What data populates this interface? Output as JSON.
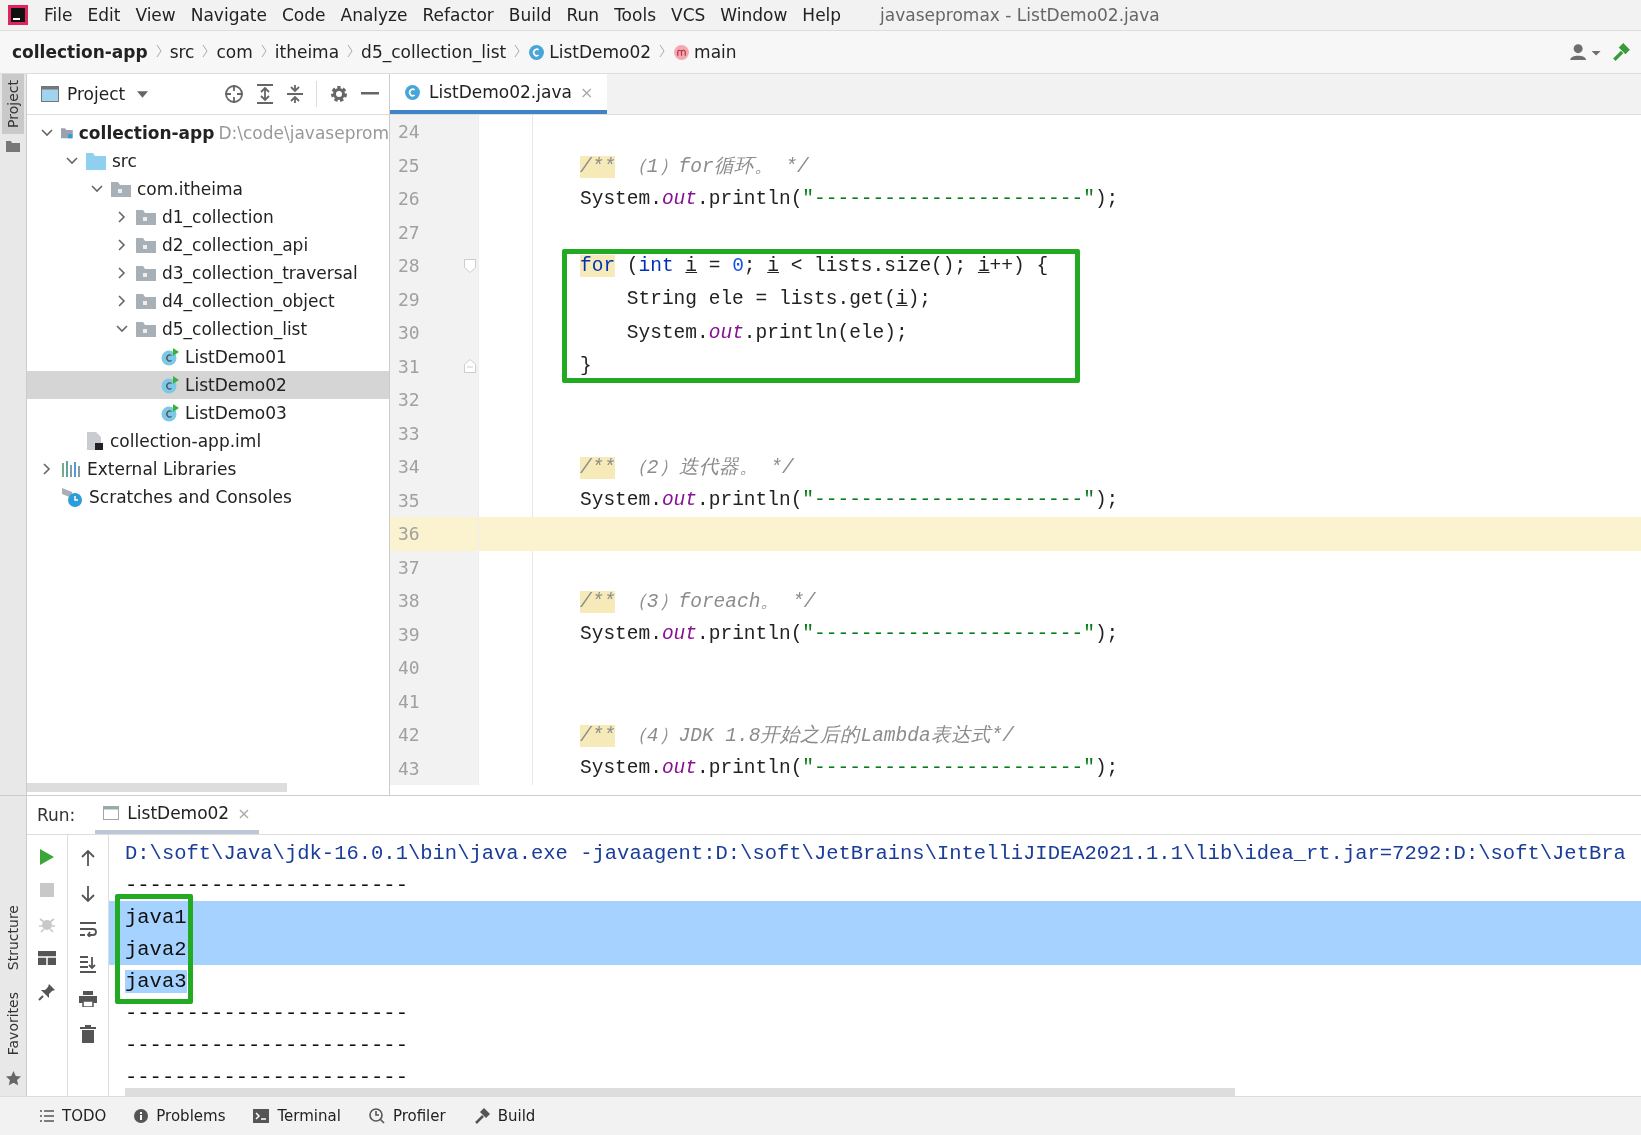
{
  "menu_bar": {
    "items": [
      "File",
      "Edit",
      "View",
      "Navigate",
      "Code",
      "Analyze",
      "Refactor",
      "Build",
      "Run",
      "Tools",
      "VCS",
      "Window",
      "Help"
    ],
    "title": "javasepromax - ListDemo02.java"
  },
  "breadcrumb": [
    {
      "label": "collection-app",
      "kind": "module"
    },
    {
      "label": "src",
      "kind": "folder"
    },
    {
      "label": "com",
      "kind": "folder"
    },
    {
      "label": "itheima",
      "kind": "folder"
    },
    {
      "label": "d5_collection_list",
      "kind": "folder"
    },
    {
      "label": "ListDemo02",
      "kind": "class"
    },
    {
      "label": "main",
      "kind": "method"
    }
  ],
  "left_strip": [
    "Project",
    "Structure",
    "Favorites"
  ],
  "project_panel": {
    "title": "Project",
    "items": [
      {
        "label": "collection-app",
        "note": "D:\\code\\javaseprom",
        "kind": "module",
        "expanded": true,
        "selected": false,
        "children": [
          {
            "label": "src",
            "kind": "source",
            "expanded": true,
            "selected": false,
            "children": [
              {
                "label": "com.itheima",
                "kind": "package",
                "expanded": true,
                "selected": false,
                "children": [
                  {
                    "label": "d1_collection",
                    "kind": "package",
                    "expanded": false,
                    "selected": false
                  },
                  {
                    "label": "d2_collection_api",
                    "kind": "package",
                    "expanded": false,
                    "selected": false
                  },
                  {
                    "label": "d3_collection_traversal",
                    "kind": "package",
                    "expanded": false,
                    "selected": false
                  },
                  {
                    "label": "d4_collection_object",
                    "kind": "package",
                    "expanded": false,
                    "selected": false
                  },
                  {
                    "label": "d5_collection_list",
                    "kind": "package",
                    "expanded": true,
                    "selected": false,
                    "children": [
                      {
                        "label": "ListDemo01",
                        "kind": "class",
                        "selected": false
                      },
                      {
                        "label": "ListDemo02",
                        "kind": "class",
                        "selected": true
                      },
                      {
                        "label": "ListDemo03",
                        "kind": "class",
                        "selected": false
                      }
                    ]
                  }
                ]
              }
            ]
          },
          {
            "label": "collection-app.iml",
            "kind": "file",
            "selected": false
          }
        ]
      },
      {
        "label": "External Libraries",
        "kind": "library",
        "expanded": false,
        "selected": false
      },
      {
        "label": "Scratches and Consoles",
        "kind": "scratch",
        "selected": false
      }
    ]
  },
  "editor": {
    "tab": {
      "label": "ListDemo02.java",
      "close": "×",
      "selected": true
    },
    "lines": [
      {
        "number": "24",
        "kind": "code",
        "current": false,
        "boxed": false
      },
      {
        "number": "25",
        "kind": "code",
        "current": false,
        "boxed": false,
        "segments": [
          {
            "kind": "marker",
            "text": "/**"
          },
          {
            "kind": "comment",
            "text": " （1）for循环。 */"
          }
        ]
      },
      {
        "number": "26",
        "kind": "code",
        "current": false,
        "boxed": false,
        "segments": [
          {
            "kind": "plain",
            "text": "System."
          },
          {
            "kind": "field",
            "text": "out"
          },
          {
            "kind": "plain",
            "text": ".println("
          },
          {
            "kind": "string",
            "text": "\"-----------------------\""
          },
          {
            "kind": "plain",
            "text": ");"
          }
        ]
      },
      {
        "number": "27",
        "kind": "code",
        "current": false,
        "boxed": false
      },
      {
        "number": "28",
        "kind": "fold-start",
        "current": false,
        "boxed": true,
        "segments": [
          {
            "kind": "keyword-match",
            "text": "for"
          },
          {
            "kind": "plain",
            "text": " ("
          },
          {
            "kind": "keyword",
            "text": "int "
          },
          {
            "kind": "var",
            "text": "i"
          },
          {
            "kind": "plain",
            "text": " = "
          },
          {
            "kind": "number",
            "text": "0"
          },
          {
            "kind": "plain",
            "text": "; "
          },
          {
            "kind": "var",
            "text": "i"
          },
          {
            "kind": "plain",
            "text": " < lists.size(); "
          },
          {
            "kind": "var",
            "text": "i"
          },
          {
            "kind": "plain",
            "text": "++) {"
          }
        ]
      },
      {
        "number": "29",
        "kind": "code",
        "current": false,
        "boxed": true,
        "segments": [
          {
            "kind": "plain",
            "text": "    String ele = lists.get("
          },
          {
            "kind": "var",
            "text": "i"
          },
          {
            "kind": "plain",
            "text": ");"
          }
        ]
      },
      {
        "number": "30",
        "kind": "code",
        "current": false,
        "boxed": true,
        "segments": [
          {
            "kind": "plain",
            "text": "    System."
          },
          {
            "kind": "field",
            "text": "out"
          },
          {
            "kind": "plain",
            "text": ".println(ele);"
          }
        ]
      },
      {
        "number": "31",
        "kind": "fold-end",
        "current": false,
        "boxed": true,
        "segments": [
          {
            "kind": "plain",
            "text": "}"
          }
        ]
      },
      {
        "number": "32",
        "kind": "code",
        "current": false,
        "boxed": false
      },
      {
        "number": "33",
        "kind": "code",
        "current": false,
        "boxed": false
      },
      {
        "number": "34",
        "kind": "code",
        "current": false,
        "boxed": false,
        "segments": [
          {
            "kind": "marker",
            "text": "/**"
          },
          {
            "kind": "comment",
            "text": " （2）迭代器。 */"
          }
        ]
      },
      {
        "number": "35",
        "kind": "code",
        "current": false,
        "boxed": false,
        "segments": [
          {
            "kind": "plain",
            "text": "System."
          },
          {
            "kind": "field",
            "text": "out"
          },
          {
            "kind": "plain",
            "text": ".println("
          },
          {
            "kind": "string",
            "text": "\"-----------------------\""
          },
          {
            "kind": "plain",
            "text": ");"
          }
        ]
      },
      {
        "number": "36",
        "kind": "code",
        "current": true,
        "boxed": false
      },
      {
        "number": "37",
        "kind": "code",
        "current": false,
        "boxed": false
      },
      {
        "number": "38",
        "kind": "code",
        "current": false,
        "boxed": false,
        "segments": [
          {
            "kind": "marker",
            "text": "/**"
          },
          {
            "kind": "comment",
            "text": " （3）foreach。 */"
          }
        ]
      },
      {
        "number": "39",
        "kind": "code",
        "current": false,
        "boxed": false,
        "segments": [
          {
            "kind": "plain",
            "text": "System."
          },
          {
            "kind": "field",
            "text": "out"
          },
          {
            "kind": "plain",
            "text": ".println("
          },
          {
            "kind": "string",
            "text": "\"-----------------------\""
          },
          {
            "kind": "plain",
            "text": ");"
          }
        ]
      },
      {
        "number": "40",
        "kind": "code",
        "current": false,
        "boxed": false
      },
      {
        "number": "41",
        "kind": "code",
        "current": false,
        "boxed": false
      },
      {
        "number": "42",
        "kind": "code",
        "current": false,
        "boxed": false,
        "segments": [
          {
            "kind": "marker",
            "text": "/**"
          },
          {
            "kind": "comment",
            "text": " （4）JDK 1.8开始之后的Lambda表达式*/"
          }
        ]
      },
      {
        "number": "43",
        "kind": "code",
        "current": false,
        "boxed": false,
        "segments": [
          {
            "kind": "plain",
            "text": "System."
          },
          {
            "kind": "field",
            "text": "out"
          },
          {
            "kind": "plain",
            "text": ".println("
          },
          {
            "kind": "string",
            "text": "\"-----------------------\""
          },
          {
            "kind": "plain",
            "text": ");"
          }
        ]
      }
    ]
  },
  "run_panel": {
    "label": "Run:",
    "tab": {
      "label": "ListDemo02",
      "close": "×",
      "selected": true
    },
    "console": [
      {
        "text": "D:\\soft\\Java\\jdk-16.0.1\\bin\\java.exe -javaagent:D:\\soft\\JetBrains\\IntelliJIDEA2021.1.1\\lib\\idea_rt.jar=7292:D:\\soft\\JetBra",
        "kind": "command",
        "boxed": false,
        "selected": false
      },
      {
        "text": "-----------------------",
        "kind": "output",
        "boxed": false,
        "selected": false
      },
      {
        "text": "java1",
        "kind": "output",
        "boxed": true,
        "selected": true
      },
      {
        "text": "java2",
        "kind": "output",
        "boxed": true,
        "selected": true
      },
      {
        "text": "java3",
        "kind": "output",
        "boxed": true,
        "selected": true
      },
      {
        "text": "-----------------------",
        "kind": "output",
        "boxed": false,
        "selected": false
      },
      {
        "text": "-----------------------",
        "kind": "output",
        "boxed": false,
        "selected": false
      },
      {
        "text": "-----------------------",
        "kind": "output",
        "boxed": false,
        "selected": false
      }
    ]
  },
  "bottom_bar": [
    {
      "label": "TODO",
      "kind": "list"
    },
    {
      "label": "Problems",
      "kind": "info"
    },
    {
      "label": "Terminal",
      "kind": "terminal"
    },
    {
      "label": "Profiler",
      "kind": "profiler"
    },
    {
      "label": "Build",
      "kind": "hammer"
    }
  ]
}
